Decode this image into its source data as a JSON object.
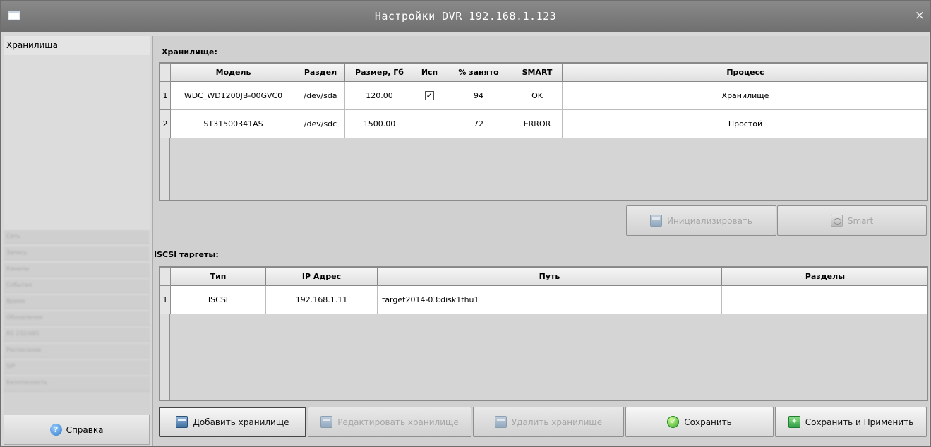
{
  "window": {
    "title": "Настройки DVR 192.168.1.123",
    "close_icon": "×"
  },
  "sidebar": {
    "active": "Хранилища",
    "items": [
      "Сеть",
      "Запись",
      "Каналы",
      "События",
      "Время",
      "Обновления",
      "RS 232/485",
      "Расписание",
      "SIP",
      "Безопасность"
    ],
    "help_label": "Справка"
  },
  "storage": {
    "title": "Хранилище:",
    "columns": [
      "Модель",
      "Раздел",
      "Размер, Гб",
      "Исп",
      "% занято",
      "SMART",
      "Процесс"
    ],
    "rows": [
      {
        "num": "1",
        "model": "WDC_WD1200JB-00GVC0",
        "partition": "/dev/sda",
        "size": "120.00",
        "used": true,
        "occupied": "94",
        "smart": "OK",
        "process": "Хранилище"
      },
      {
        "num": "2",
        "model": "ST31500341AS",
        "partition": "/dev/sdc",
        "size": "1500.00",
        "used": false,
        "occupied": "72",
        "smart": "ERROR",
        "process": "Простой"
      }
    ],
    "buttons": {
      "initialize": "Инициализировать",
      "smart": "Smart"
    }
  },
  "iscsi": {
    "title": "ISCSI таргеты:",
    "columns": [
      "Тип",
      "IP Адрес",
      "Путь",
      "Разделы"
    ],
    "rows": [
      {
        "num": "1",
        "type": "ISCSI",
        "ip": "192.168.1.11",
        "path": "target2014-03:disk1thu1",
        "partitions": ""
      }
    ]
  },
  "bottom_buttons": {
    "add": "Добавить хранилище",
    "edit": "Редактировать хранилище",
    "delete": "Удалить хранилище",
    "save": "Сохранить",
    "save_apply": "Сохранить и Применить"
  },
  "icons": {
    "help": "help-icon",
    "storage": "storage-icon",
    "save": "checkmark-icon",
    "apply": "apply-icon",
    "initialize": "database-icon",
    "smart": "disk-icon"
  }
}
